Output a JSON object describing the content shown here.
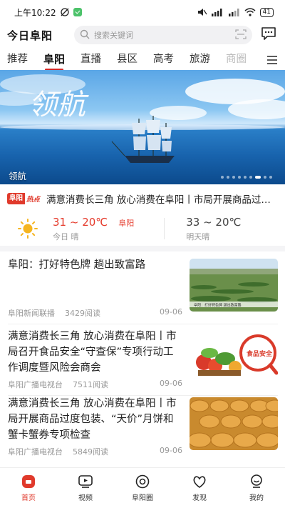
{
  "status_bar": {
    "time": "上午10:22",
    "battery": "41"
  },
  "header": {
    "app_title": "今日阜阳",
    "search_placeholder": "搜索关键词"
  },
  "tabs": [
    {
      "label": "推荐"
    },
    {
      "label": "阜阳"
    },
    {
      "label": "直播"
    },
    {
      "label": "县区"
    },
    {
      "label": "高考"
    },
    {
      "label": "旅游"
    },
    {
      "label": "商圈"
    }
  ],
  "active_tab": "阜阳",
  "banner": {
    "calligraphy": "领航",
    "caption": "领航",
    "slide_count": 9,
    "active_slide": 7
  },
  "hot": {
    "badge_a": "阜阳",
    "badge_b": "热点",
    "text": "满意消费长三角 放心消费在阜阳丨市局开展商品过度包装"
  },
  "weather": {
    "today_temp": "31 ~ 20℃",
    "city": "阜阳",
    "today_label": "今日 晴",
    "tomorrow_temp": "33 ~ 20℃",
    "tomorrow_label": "明天晴"
  },
  "news": [
    {
      "title": "阜阳：打好特色牌 趟出致富路",
      "source": "阜阳新闻联播",
      "reads": "3429阅读",
      "date": "09-06",
      "thumb_text": "阜阳：打好特色牌 趟出致富路"
    },
    {
      "title": "满意消费长三角 放心消费在阜阳丨市局召开食品安全“守查保”专项行动工作调度暨风险会商会",
      "source": "阜阳广播电视台",
      "reads": "7511阅读",
      "date": "09-06",
      "thumb_text": "食品安全"
    },
    {
      "title": "满意消费长三角 放心消费在阜阳丨市局开展商品过度包装、“天价”月饼和蟹卡蟹券专项检查",
      "source": "阜阳广播电视台",
      "reads": "5849阅读",
      "date": "09-06",
      "thumb_text": ""
    }
  ],
  "bottom_nav": [
    {
      "label": "首页",
      "icon": "home-icon",
      "active": true
    },
    {
      "label": "视频",
      "icon": "video-icon",
      "active": false
    },
    {
      "label": "阜阳圈",
      "icon": "circle-icon",
      "active": false
    },
    {
      "label": "发现",
      "icon": "discover-icon",
      "active": false
    },
    {
      "label": "我的",
      "icon": "profile-icon",
      "active": false
    }
  ],
  "colors": {
    "accent": "#e03a2c",
    "weather_red": "#e53b2c"
  }
}
